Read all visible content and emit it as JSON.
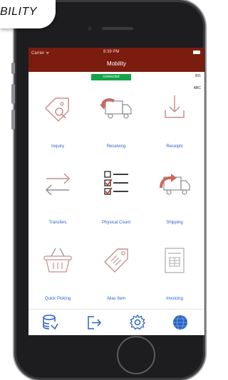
{
  "banner": {
    "text": "BILITY"
  },
  "status": {
    "carrier": "Carrier ᯤ",
    "time": "8:39 PM"
  },
  "nav": {
    "title": "Mobility"
  },
  "connection": {
    "status": "connected"
  },
  "codes": {
    "line1": "001",
    "line2": "ABC"
  },
  "tiles": [
    {
      "label": "Inquiry",
      "icon": "tag-search-icon"
    },
    {
      "label": "Receiving",
      "icon": "truck-receive-icon"
    },
    {
      "label": "Receipts",
      "icon": "download-tray-icon"
    },
    {
      "label": "Transfers",
      "icon": "transfer-arrows-icon"
    },
    {
      "label": "Physical Count",
      "icon": "checklist-icon"
    },
    {
      "label": "Shipping",
      "icon": "truck-ship-icon"
    },
    {
      "label": "Quick Picking",
      "icon": "basket-icon"
    },
    {
      "label": "Alias Item",
      "icon": "tag-icon"
    },
    {
      "label": "Invoicing",
      "icon": "invoice-icon"
    }
  ],
  "tabbar": {
    "items": [
      "database-icon",
      "logout-icon",
      "gear-icon",
      "globe-icon"
    ]
  },
  "colors": {
    "brand": "#7b1c0f",
    "accent": "#2a64c5",
    "connected": "#14a349",
    "icon_muted": "#c98f8f"
  }
}
